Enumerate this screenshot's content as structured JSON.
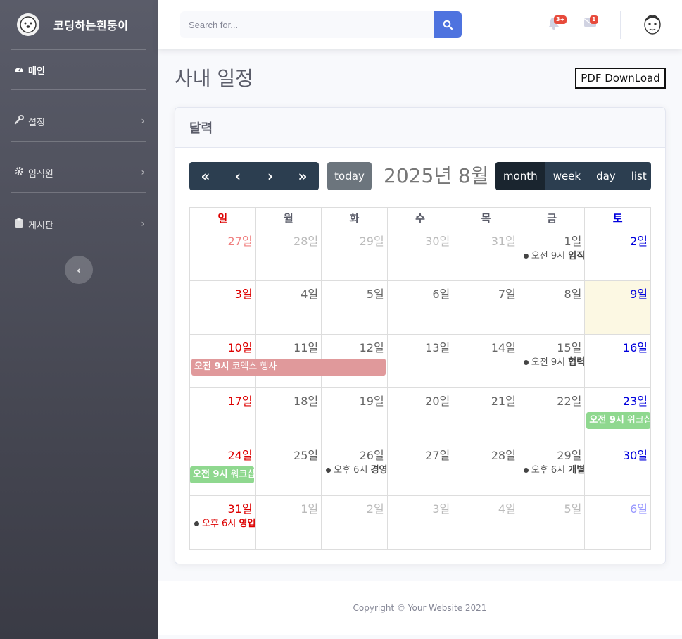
{
  "brand": {
    "name": "코딩하는흰둥이",
    "logo_icon": "dog-face-icon"
  },
  "sidebar": {
    "items": [
      {
        "label": "매인",
        "icon": "dashboard-icon"
      },
      {
        "label": "설정",
        "icon": "wrench-icon"
      },
      {
        "label": "임직원",
        "icon": "gear-icon"
      },
      {
        "label": "게시판",
        "icon": "clipboard-icon"
      }
    ]
  },
  "topbar": {
    "search_placeholder": "Search for...",
    "alerts_badge": "3+",
    "messages_badge": "1"
  },
  "page": {
    "title": "사내 일정",
    "pdf_button": "PDF DownLoad",
    "card_title": "달력"
  },
  "calendar": {
    "title": "2025년 8월",
    "today_label": "today",
    "views": [
      "month",
      "week",
      "day",
      "list"
    ],
    "active_view": "month",
    "weekdays": [
      "일",
      "월",
      "화",
      "수",
      "목",
      "금",
      "토"
    ],
    "weeks": [
      [
        "27일",
        "28일",
        "29일",
        "30일",
        "31일",
        "1일",
        "2일"
      ],
      [
        "3일",
        "4일",
        "5일",
        "6일",
        "7일",
        "8일",
        "9일"
      ],
      [
        "10일",
        "11일",
        "12일",
        "13일",
        "14일",
        "15일",
        "16일"
      ],
      [
        "17일",
        "18일",
        "19일",
        "20일",
        "21일",
        "22일",
        "23일"
      ],
      [
        "24일",
        "25일",
        "26일",
        "27일",
        "28일",
        "29일",
        "30일"
      ],
      [
        "31일",
        "1일",
        "2일",
        "3일",
        "4일",
        "5일",
        "6일"
      ]
    ],
    "dot_events": {
      "w0d5": {
        "time": "오전 9시",
        "title": "임직"
      },
      "w2d5": {
        "time": "오전 9시",
        "title": "협력"
      },
      "w4d2": {
        "time": "오후 6시",
        "title": "경영"
      },
      "w4d5": {
        "time": "오후 6시",
        "title": "개별"
      },
      "w5d0": {
        "time": "오후 6시",
        "title": "영업"
      }
    },
    "bar_events": {
      "coex": {
        "time": "오전 9시",
        "title": "코엑스 행사",
        "color": "#e0999b"
      },
      "ws23": {
        "time": "오전 9시",
        "title": "워크샵",
        "color": "#8fd88f"
      },
      "ws24": {
        "time": "오전 9시",
        "title": "워크샵",
        "color": "#8fd88f"
      }
    }
  },
  "footer": {
    "text": "Copyright © Your Website 2021"
  },
  "colors": {
    "primary": "#4e73df",
    "sidebar": "#5a5c69",
    "toolbar": "#2c3e50",
    "sunday": "#dd0000",
    "saturday": "#0000dd"
  }
}
